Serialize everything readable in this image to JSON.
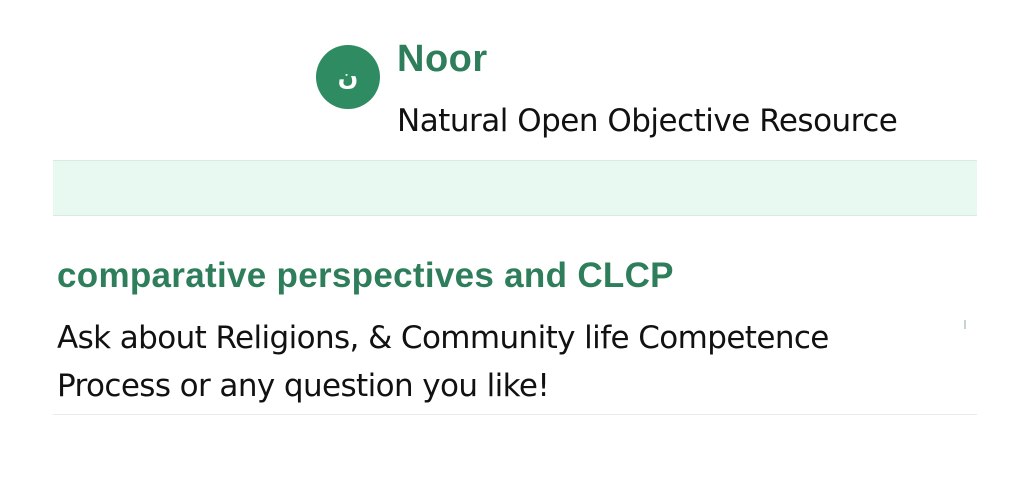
{
  "app": {
    "logo_glyph": "ن",
    "name": "Noor",
    "subtitle": "Natural Open Objective Resource"
  },
  "chat": {
    "heading": "comparative perspectives and CLCP",
    "prompt": "Ask about Religions, & Community life Competence Process or any question you like!"
  },
  "colors": {
    "brand_green": "#2e8b62",
    "heading_green": "#2e7d5b",
    "band_tint": "#e7f9f0",
    "text": "#111111"
  }
}
